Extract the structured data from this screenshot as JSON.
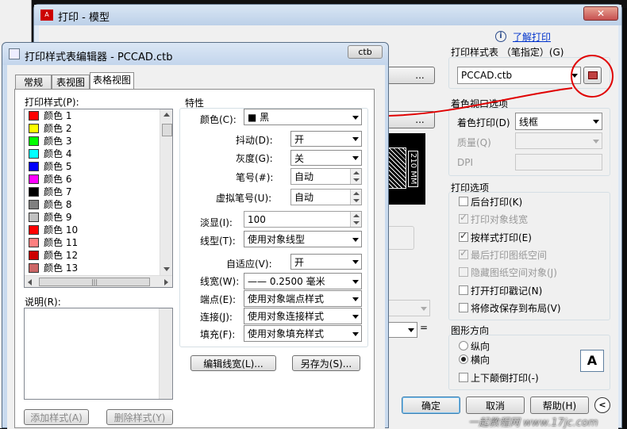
{
  "main_dialog": {
    "title": "打印 - 模型",
    "learn_link": "了解打印",
    "plot_style_table_label": "打印样式表 （笔指定）(G)",
    "plot_style_value": "PCCAD.ctb",
    "shaded_viewport_label": "着色视口选项",
    "shade_plot_label": "着色打印(D)",
    "shade_plot_value": "线框",
    "quality_label": "质量(Q)",
    "dpi_label": "DPI",
    "plot_options_label": "打印选项",
    "options": [
      {
        "label": "后台打印(K)",
        "checked": false,
        "disabled": false
      },
      {
        "label": "打印对象线宽",
        "checked": true,
        "disabled": true
      },
      {
        "label": "按样式打印(E)",
        "checked": true,
        "disabled": false
      },
      {
        "label": "最后打印图纸空间",
        "checked": true,
        "disabled": true
      },
      {
        "label": "隐藏图纸空间对象(J)",
        "checked": false,
        "disabled": true
      },
      {
        "label": "打开打印戳记(N)",
        "checked": false,
        "disabled": false
      },
      {
        "label": "将修改保存到布局(V)",
        "checked": false,
        "disabled": false
      }
    ],
    "orientation_label": "图形方向",
    "portrait_label": "纵向",
    "landscape_label": "横向",
    "upside_down_label": "上下颠倒打印(-)",
    "orientation_icon_letter": "A",
    "paper_dim": "210 MM",
    "ok_label": "确定",
    "cancel_label": "取消",
    "help_label": "帮助(H)",
    "ellipsis": "...",
    "equals": "="
  },
  "editor": {
    "title": "打印样式表编辑器 - PCCAD.ctb",
    "close_label": "ctb",
    "tabs": [
      "常规",
      "表视图",
      "表格视图"
    ],
    "active_tab": 2,
    "styles_label": "打印样式(P):",
    "styles": [
      {
        "name": "颜色  1",
        "color": "#ff0000"
      },
      {
        "name": "颜色  2",
        "color": "#ffff00"
      },
      {
        "name": "颜色  3",
        "color": "#00ff00"
      },
      {
        "name": "颜色  4",
        "color": "#00ffff"
      },
      {
        "name": "颜色  5",
        "color": "#0000ff"
      },
      {
        "name": "颜色  6",
        "color": "#ff00ff"
      },
      {
        "name": "颜色  7",
        "color": "#000000"
      },
      {
        "name": "颜色  8",
        "color": "#808080"
      },
      {
        "name": "颜色  9",
        "color": "#c0c0c0"
      },
      {
        "name": "颜色  10",
        "color": "#ff0000"
      },
      {
        "name": "颜色  11",
        "color": "#ff7f7f"
      },
      {
        "name": "颜色  12",
        "color": "#cc0000"
      },
      {
        "name": "颜色  13",
        "color": "#cc6666"
      }
    ],
    "description_label": "说明(R):",
    "properties_label": "特性",
    "color_label": "颜色(C):",
    "color_value": "■ 黑",
    "dither_label": "抖动(D):",
    "dither_value": "开",
    "grayscale_label": "灰度(G):",
    "grayscale_value": "关",
    "pen_label": "笔号(#):",
    "pen_value": "自动",
    "vpen_label": "虚拟笔号(U):",
    "vpen_value": "自动",
    "screening_label": "淡显(I):",
    "screening_value": "100",
    "linetype_label": "线型(T):",
    "linetype_value": "使用对象线型",
    "adaptive_label": "自适应(V):",
    "adaptive_value": "开",
    "lineweight_label": "线宽(W):",
    "lineweight_value": "—— 0.2500 毫米",
    "endstyle_label": "端点(E):",
    "endstyle_value": "使用对象端点样式",
    "joinstyle_label": "连接(J):",
    "joinstyle_value": "使用对象连接样式",
    "fill_label": "填充(F):",
    "fill_value": "使用对象填充样式",
    "edit_lw_label": "编辑线宽(L)...",
    "save_as_label": "另存为(S)...",
    "add_style_label": "添加样式(A)",
    "delete_style_label": "删除样式(Y)"
  },
  "watermark": "一起教程网 www.17jc.com"
}
